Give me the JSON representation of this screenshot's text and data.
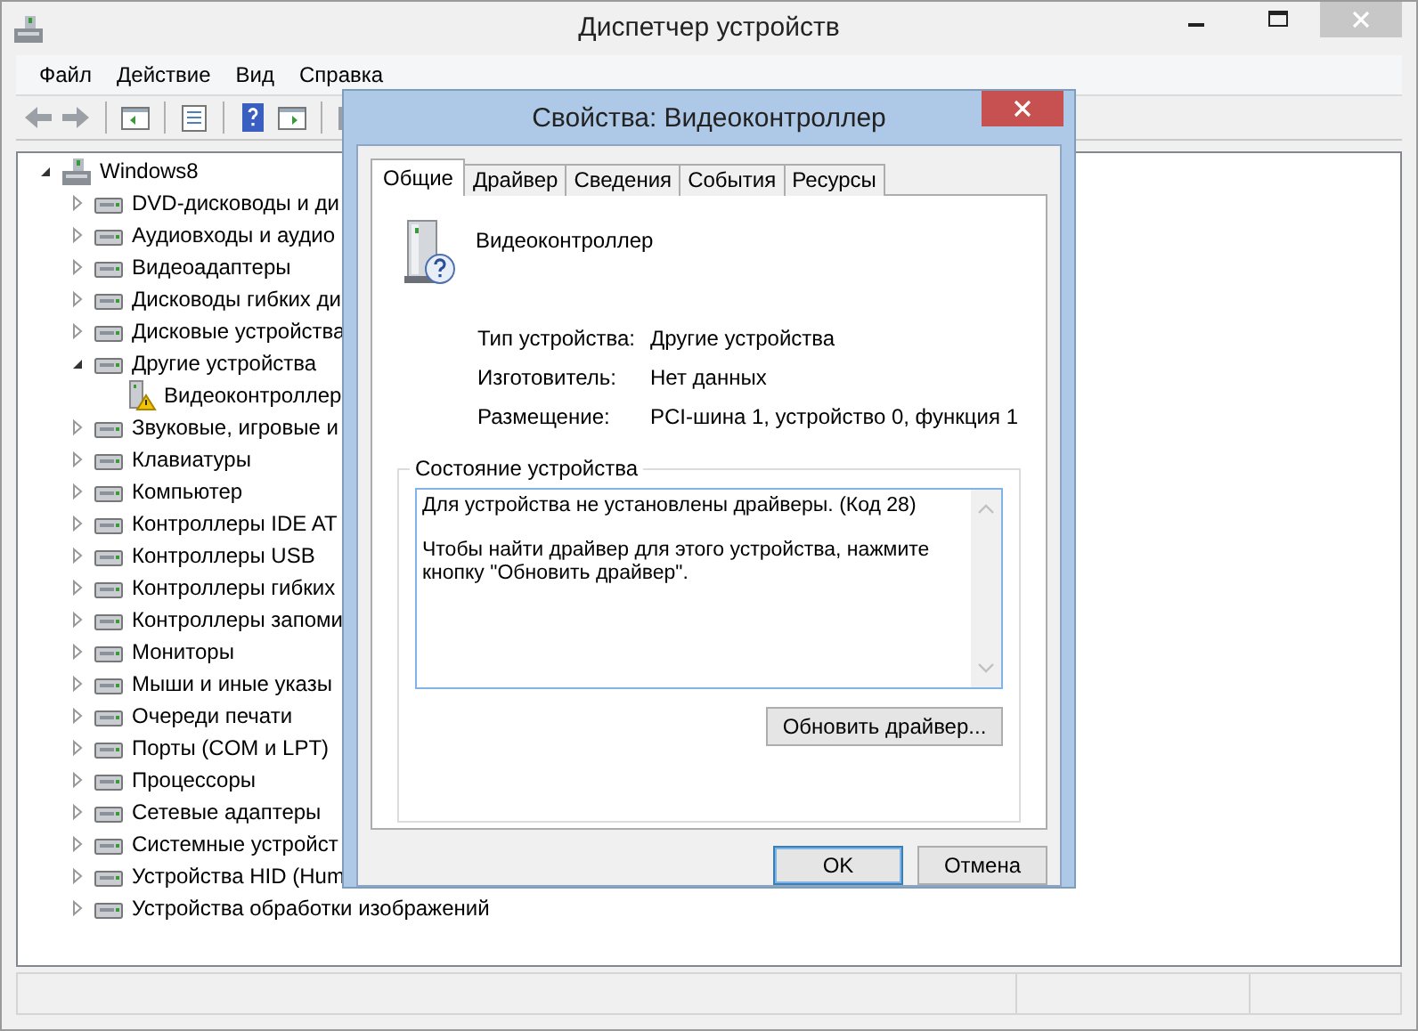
{
  "window": {
    "title": "Диспетчер устройств"
  },
  "menu": [
    "Файл",
    "Действие",
    "Вид",
    "Справка"
  ],
  "tree": {
    "label": "Windows8",
    "expanded": true,
    "children": [
      {
        "label": "DVD-дисководы и ди",
        "expanded": false
      },
      {
        "label": "Аудиовходы и аудио",
        "expanded": false
      },
      {
        "label": "Видеоадаптеры",
        "expanded": false
      },
      {
        "label": "Дисководы гибких ди",
        "expanded": false
      },
      {
        "label": "Дисковые устройства",
        "expanded": false
      },
      {
        "label": "Другие устройства",
        "expanded": true,
        "children": [
          {
            "label": "Видеоконтроллер",
            "warning": true
          }
        ]
      },
      {
        "label": "Звуковые, игровые и",
        "expanded": false
      },
      {
        "label": "Клавиатуры",
        "expanded": false
      },
      {
        "label": "Компьютер",
        "expanded": false
      },
      {
        "label": "Контроллеры IDE AT",
        "expanded": false
      },
      {
        "label": "Контроллеры USB",
        "expanded": false
      },
      {
        "label": "Контроллеры гибких",
        "expanded": false
      },
      {
        "label": "Контроллеры запоми",
        "expanded": false
      },
      {
        "label": "Мониторы",
        "expanded": false
      },
      {
        "label": "Мыши и иные указы",
        "expanded": false
      },
      {
        "label": "Очереди печати",
        "expanded": false
      },
      {
        "label": "Порты (COM и LPT)",
        "expanded": false
      },
      {
        "label": "Процессоры",
        "expanded": false
      },
      {
        "label": "Сетевые адаптеры",
        "expanded": false
      },
      {
        "label": "Системные устройст",
        "expanded": false
      },
      {
        "label": "Устройства HID (Hum",
        "expanded": false
      },
      {
        "label": "Устройства обработки изображений",
        "expanded": false
      }
    ]
  },
  "dialog": {
    "title": "Свойства: Видеоконтроллер",
    "tabs": [
      {
        "label": "Общие",
        "selected": true
      },
      {
        "label": "Драйвер",
        "selected": false
      },
      {
        "label": "Сведения",
        "selected": false
      },
      {
        "label": "События",
        "selected": false
      },
      {
        "label": "Ресурсы",
        "selected": false
      }
    ],
    "device_name": "Видеоконтроллер",
    "properties": [
      {
        "label": "Тип устройства:",
        "value": "Другие устройства"
      },
      {
        "label": "Изготовитель:",
        "value": "Нет данных"
      },
      {
        "label": "Размещение:",
        "value": "PCI-шина 1, устройство 0, функция 1"
      }
    ],
    "status_group": {
      "title": "Состояние устройства",
      "paragraphs": [
        "Для устройства не установлены драйверы. (Код 28)",
        "Чтобы найти драйвер для этого устройства, нажмите кнопку \"Обновить драйвер\"."
      ]
    },
    "update_button": "Обновить драйвер...",
    "buttons": [
      {
        "label": "OK",
        "default": true
      },
      {
        "label": "Отмена",
        "default": false
      }
    ]
  }
}
